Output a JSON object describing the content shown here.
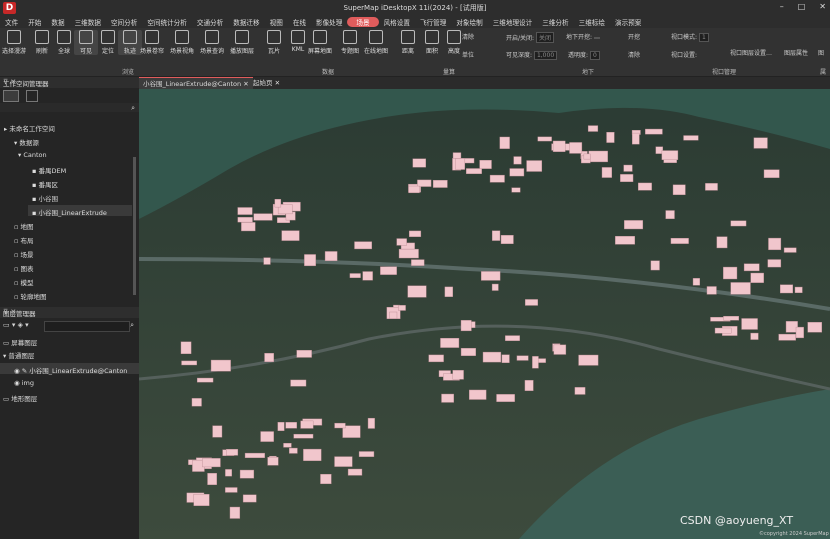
{
  "app": {
    "logo_letter": "D",
    "title": "SuperMap iDesktopX 11i(2024) - [试用版]"
  },
  "window_controls": [
    "–",
    "□",
    "✕"
  ],
  "menu": [
    "文件",
    "开始",
    "数据",
    "三维数据",
    "空间分析",
    "空间统计分析",
    "交通分析",
    "数据迁移",
    "视图",
    "在线",
    "影像处理",
    "场景",
    "风格设置",
    "飞行管理",
    "对象绘制",
    "三维地理设计",
    "三维分析",
    "三维标绘",
    "演示预案"
  ],
  "menu_active_index": 11,
  "ribbon": {
    "buttons": [
      "选择漫游",
      "刷新",
      "全球",
      "可见",
      "定位",
      "轨迹",
      "场景卷帘",
      "场景视角",
      "场景查询",
      "播放图层",
      "瓦片",
      "KML",
      "屏幕地面",
      "专题图",
      "在线地图",
      "距离",
      "面积",
      "高度"
    ],
    "selected_indices": [
      3,
      5
    ],
    "small": {
      "clear1": "清除",
      "unit": "单位",
      "on_off_label": "开启/关闭:",
      "on_off_value": "关闭",
      "underground_label": "地下开挖:",
      "underground_value": "",
      "visible_depth_label": "可见深度:",
      "visible_depth_value": "1,000",
      "transparency_label": "透明度:",
      "transparency_value": "0",
      "kai_wa": "开挖",
      "clear2": "清除",
      "view_mode_label": "视口模式:",
      "view_mode_value": "1",
      "view_setting_label": "视口设置:",
      "view_layout": "视口图层设置…",
      "layer_prop": "图层属性",
      "layer_ctrl": "图"
    },
    "groups": [
      "浏览",
      "数据",
      "量算",
      "地下",
      "视口管理",
      "属"
    ]
  },
  "workspace": {
    "title": "工作空间管理器",
    "tree": [
      "未命名工作空间",
      "数据源",
      "Canton",
      "番禺DEM",
      "番禺区",
      "小谷围",
      "小谷围_LinearExtrude",
      "地图",
      "布局",
      "场景",
      "图表",
      "模型",
      "轮廓地图"
    ]
  },
  "layers": {
    "title": "图层管理器",
    "tree": [
      "屏幕图层",
      "普通图层",
      "小谷围_LinearExtrude@Canton",
      "img",
      "地形图层"
    ]
  },
  "tabs": [
    "小谷围_LinearExtrude@Canton",
    "起始页"
  ],
  "scene_credit": "©copyright 2024 SuperMap",
  "watermark": "CSDN @aoyueng_XT",
  "colors": {
    "accent": "#e05c5c",
    "water": "#3b5e55",
    "building": "#f1c6cc"
  }
}
